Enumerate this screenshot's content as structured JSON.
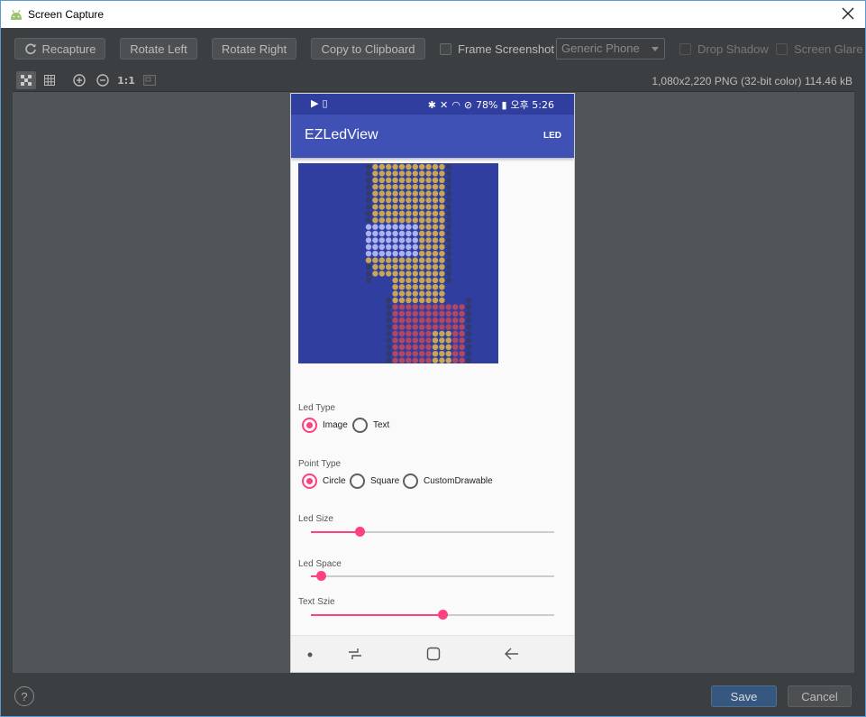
{
  "window": {
    "title": "Screen Capture"
  },
  "toolbar": {
    "recapture": "Recapture",
    "rotate_left": "Rotate Left",
    "rotate_right": "Rotate Right",
    "copy": "Copy to Clipboard",
    "frame_screenshot": "Frame Screenshot",
    "device": "Generic Phone",
    "drop_shadow": "Drop Shadow",
    "screen_glare": "Screen Glare"
  },
  "viewbar": {
    "zoom_actual": "1:1",
    "image_info": "1,080x2,220 PNG (32-bit color) 114.46 kB"
  },
  "phone": {
    "status_battery": "78%",
    "status_time": "오후 5:26",
    "app_title": "EZLedView",
    "action_label": "LED",
    "led_type_label": "Led Type",
    "led_type_options": [
      "Image",
      "Text"
    ],
    "led_type_selected": "Image",
    "point_type_label": "Point Type",
    "point_type_options": [
      "Circle",
      "Square",
      "CustomDrawable"
    ],
    "point_type_selected": "Circle",
    "led_size_label": "Led Size",
    "led_size_value": 0.2,
    "led_space_label": "Led Space",
    "led_space_value": 0.04,
    "text_size_label": "Text Szie",
    "text_size_value": 0.54
  },
  "footer": {
    "help": "?",
    "save": "Save",
    "cancel": "Cancel"
  },
  "colors": {
    "primary": "#3f51b5",
    "primary_dark": "#303f9f",
    "accent": "#ff4081",
    "ide_bg": "#3c3f41",
    "save_button": "#365880"
  }
}
